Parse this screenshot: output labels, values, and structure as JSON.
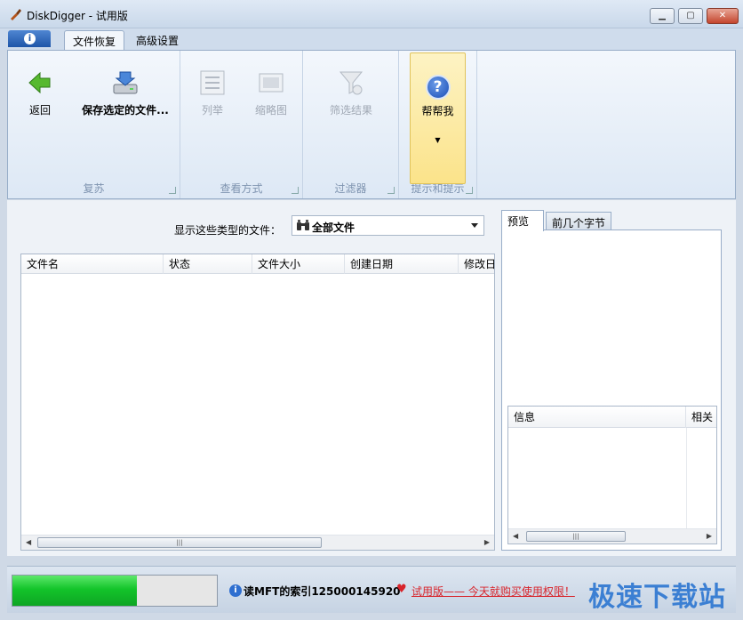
{
  "window": {
    "title": "DiskDigger - 试用版"
  },
  "tabs": [
    {
      "label": "文件恢复"
    },
    {
      "label": "高级设置"
    }
  ],
  "ribbon": {
    "groups": {
      "recover": {
        "label": "复苏"
      },
      "view": {
        "label": "查看方式"
      },
      "filter": {
        "label": "过滤器"
      },
      "tips": {
        "label": "提示和提示"
      }
    },
    "buttons": {
      "back": "返回",
      "save": "保存选定的文件...",
      "list": "列举",
      "thumbnail": "缩略图",
      "filter_results": "筛选结果",
      "help": "帮帮我"
    }
  },
  "file_filter": {
    "label": "显示这些类型的文件：",
    "selected": "全部文件"
  },
  "file_list": {
    "columns": [
      "文件名",
      "状态",
      "文件大小",
      "创建日期",
      "修改日"
    ]
  },
  "preview": {
    "tabs": [
      "预览",
      "前几个字节"
    ],
    "info_columns": [
      "信息",
      "相关"
    ]
  },
  "status": {
    "progress": 0.61,
    "message": "读MFT的索引125000145920",
    "trial_link": "试用版—— 今天就购买使用权限！"
  },
  "watermark": "极速下载站",
  "colors": {
    "progress_fill": "#13c42a",
    "trial_red": "#d8242b",
    "help_highlight": "#fbe38a"
  }
}
